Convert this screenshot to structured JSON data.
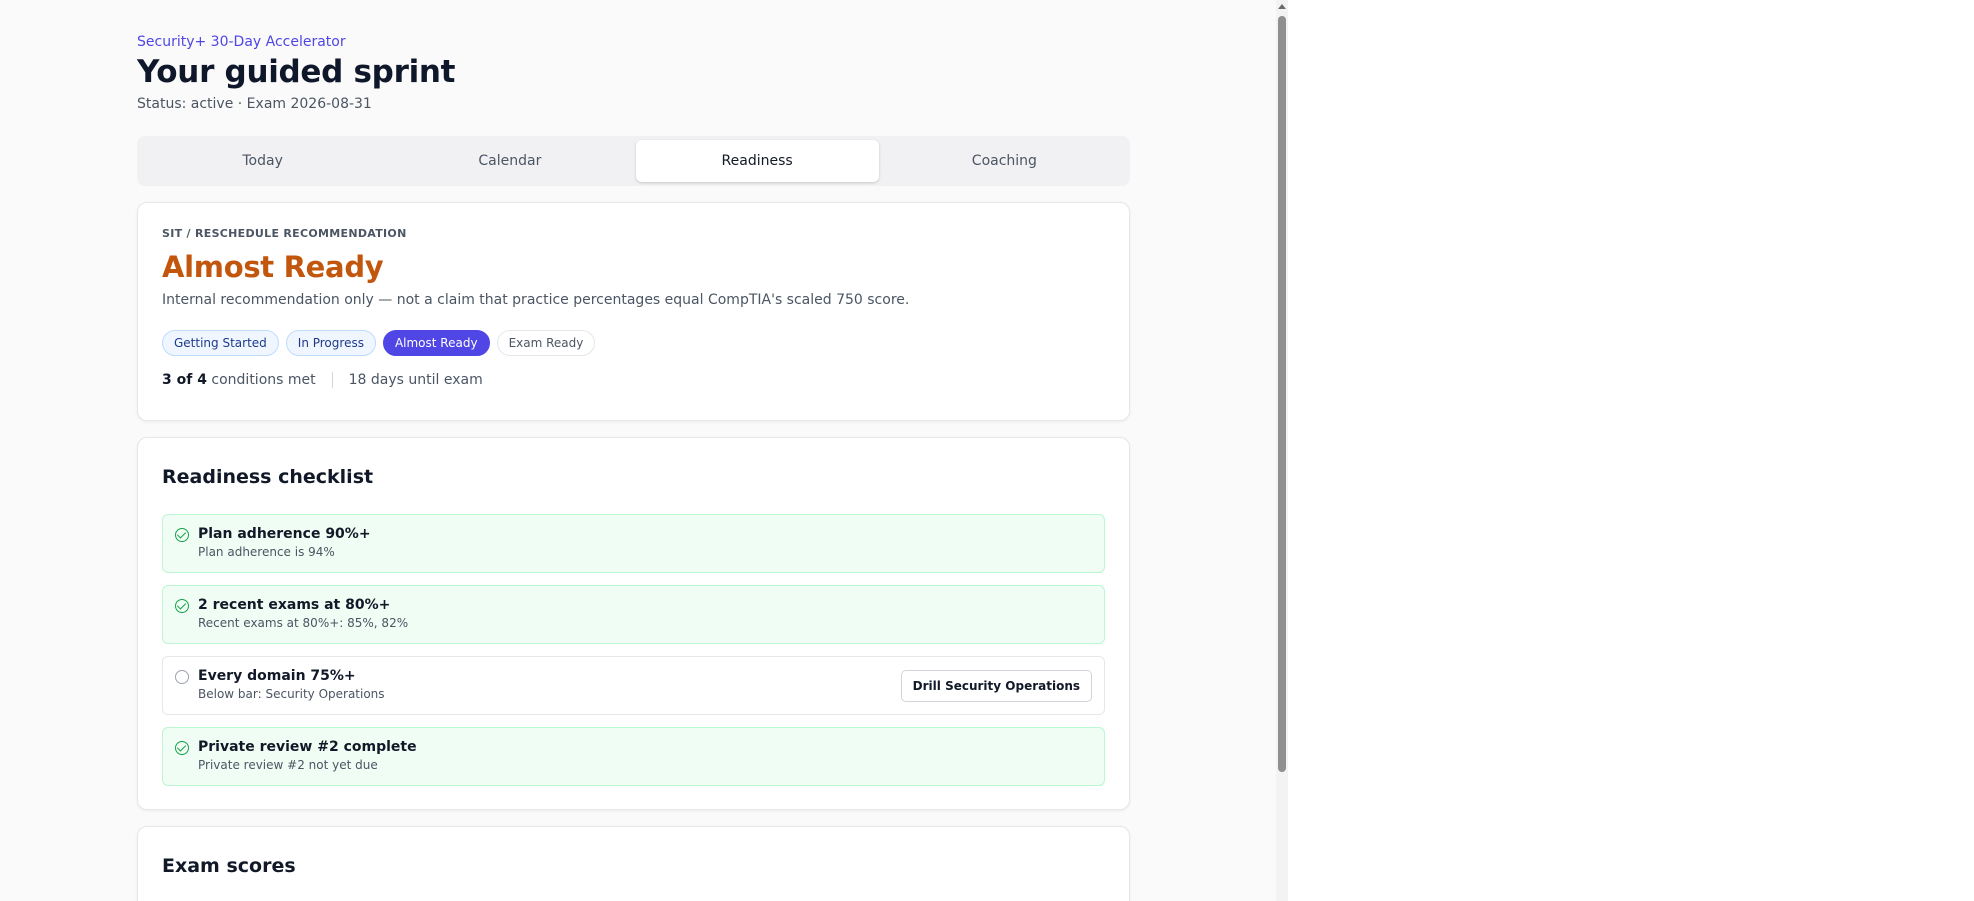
{
  "header": {
    "eyebrow": "Security+ 30-Day Accelerator",
    "title": "Your guided sprint",
    "status": "Status: active · Exam 2026-08-31"
  },
  "tabs": [
    {
      "label": "Today",
      "active": false
    },
    {
      "label": "Calendar",
      "active": false
    },
    {
      "label": "Readiness",
      "active": true
    },
    {
      "label": "Coaching",
      "active": false
    }
  ],
  "recommendation": {
    "label": "SIT / RESCHEDULE RECOMMENDATION",
    "title": "Almost Ready",
    "note": "Internal recommendation only — not a claim that practice percentages equal CompTIA's scaled 750 score.",
    "stages": [
      "Getting Started",
      "In Progress",
      "Almost Ready",
      "Exam Ready"
    ],
    "current_stage": "Almost Ready",
    "conditions_count": "3 of 4",
    "conditions_suffix": "conditions met",
    "days_until_exam": "18 days until exam"
  },
  "checklist": {
    "title": "Readiness checklist",
    "items": [
      {
        "title": "Plan adherence 90%+",
        "detail": "Plan adherence is 94%",
        "met": true
      },
      {
        "title": "2 recent exams at 80%+",
        "detail": "Recent exams at 80%+: 85%, 82%",
        "met": true
      },
      {
        "title": "Every domain 75%+",
        "detail": "Below bar: Security Operations",
        "met": false,
        "action_label": "Drill Security Operations"
      },
      {
        "title": "Private review #2 complete",
        "detail": "Private review #2 not yet due",
        "met": true
      }
    ]
  },
  "scores": {
    "title": "Exam scores"
  },
  "colors": {
    "accent": "#4f46e5",
    "recommendation": "#c2560c",
    "success": "#16a34a"
  }
}
